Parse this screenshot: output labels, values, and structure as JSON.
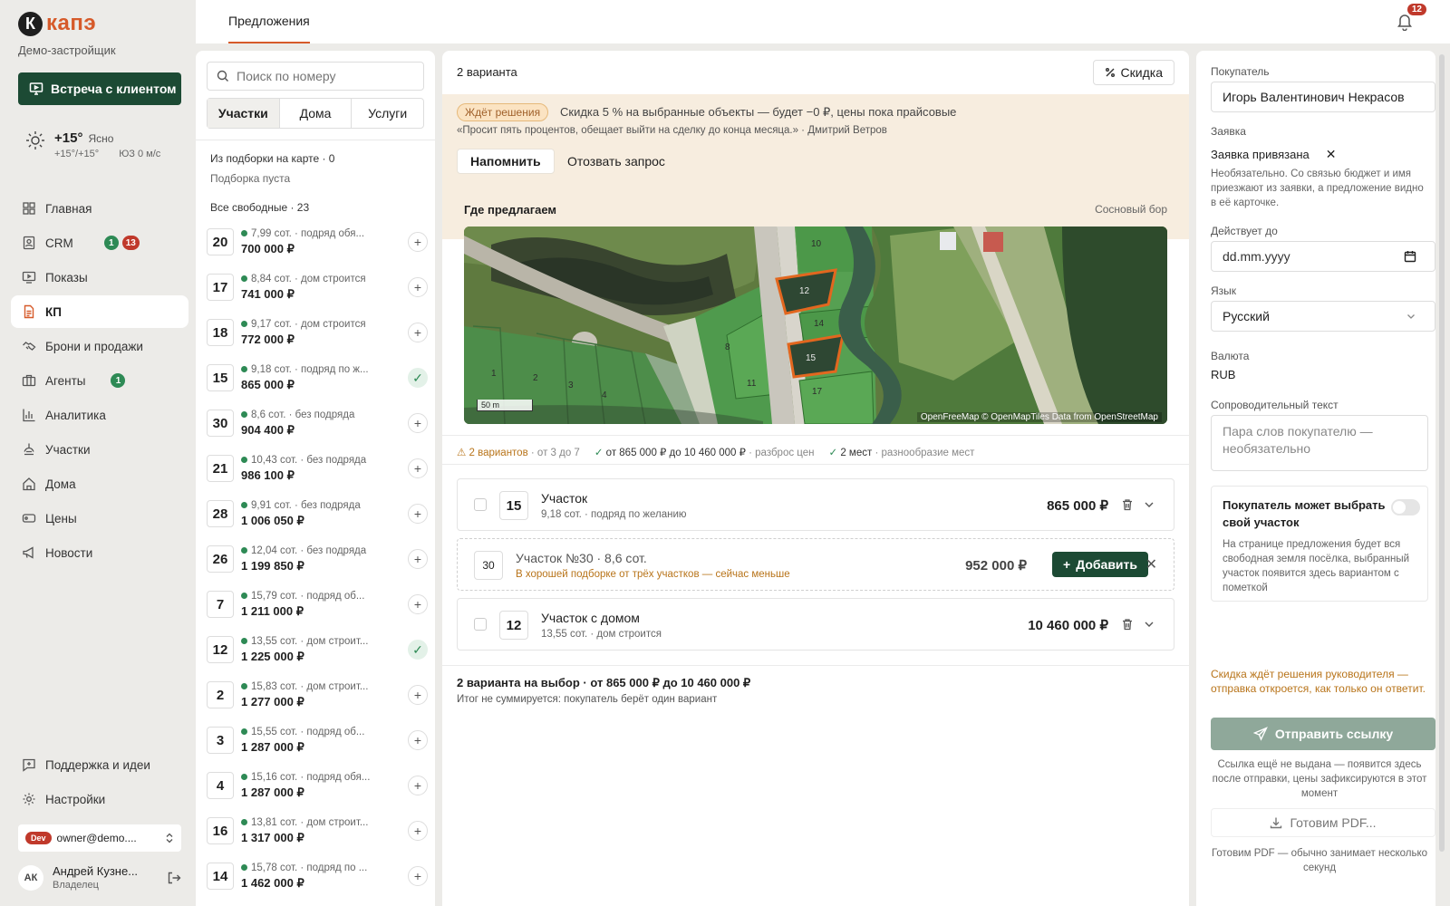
{
  "app": {
    "logo_letter": "К",
    "logo_text": "капэ",
    "company": "Демо-застройщик",
    "meeting_button": "Встреча с клиентом"
  },
  "weather": {
    "temp": "+15°",
    "condition": "Ясно",
    "range": "+15°/+15°",
    "wind": "ЮЗ 0 м/с"
  },
  "nav": {
    "items": [
      {
        "label": "Главная",
        "icon": "grid-icon"
      },
      {
        "label": "CRM",
        "icon": "contacts-icon",
        "badge_green": "1",
        "badge_red": "13"
      },
      {
        "label": "Показы",
        "icon": "screen-icon"
      },
      {
        "label": "КП",
        "icon": "document-icon",
        "active": true
      },
      {
        "label": "Брони и продажи",
        "icon": "handshake-icon"
      },
      {
        "label": "Агенты",
        "icon": "briefcase-icon",
        "badge_green": "1"
      },
      {
        "label": "Аналитика",
        "icon": "chart-icon"
      },
      {
        "label": "Участки",
        "icon": "plot-icon"
      },
      {
        "label": "Дома",
        "icon": "house-icon"
      },
      {
        "label": "Цены",
        "icon": "tag-icon"
      },
      {
        "label": "Новости",
        "icon": "megaphone-icon"
      }
    ],
    "bottom": [
      {
        "label": "Поддержка и идеи",
        "icon": "chat-icon"
      },
      {
        "label": "Настройки",
        "icon": "gear-icon"
      }
    ]
  },
  "user": {
    "env_badge": "Dev",
    "account": "owner@demo....",
    "initials": "АК",
    "name": "Андрей Кузне...",
    "role": "Владелец"
  },
  "topbar": {
    "tab": "Предложения",
    "notifications": "12"
  },
  "list": {
    "search_placeholder": "Поиск по номеру",
    "tabs": [
      "Участки",
      "Дома",
      "Услуги"
    ],
    "from_map": "Из подборки на карте · 0",
    "empty": "Подборка пуста",
    "all_free": "Все свободные · 23",
    "lots": [
      {
        "num": "20",
        "desc": "7,99 сот. · подряд обя...",
        "price": "700 000 ₽",
        "added": false
      },
      {
        "num": "17",
        "desc": "8,84 сот. · дом строится",
        "price": "741 000 ₽",
        "added": false
      },
      {
        "num": "18",
        "desc": "9,17 сот. · дом строится",
        "price": "772 000 ₽",
        "added": false
      },
      {
        "num": "15",
        "desc": "9,18 сот. · подряд по ж...",
        "price": "865 000 ₽",
        "added": true
      },
      {
        "num": "30",
        "desc": "8,6 сот. · без подряда",
        "price": "904 400 ₽",
        "added": false
      },
      {
        "num": "21",
        "desc": "10,43 сот. · без подряда",
        "price": "986 100 ₽",
        "added": false
      },
      {
        "num": "28",
        "desc": "9,91 сот. · без подряда",
        "price": "1 006 050 ₽",
        "added": false
      },
      {
        "num": "26",
        "desc": "12,04 сот. · без подряда",
        "price": "1 199 850 ₽",
        "added": false
      },
      {
        "num": "7",
        "desc": "15,79 сот. · подряд об...",
        "price": "1 211 000 ₽",
        "added": false
      },
      {
        "num": "12",
        "desc": "13,55 сот. · дом строит...",
        "price": "1 225 000 ₽",
        "added": true
      },
      {
        "num": "2",
        "desc": "15,83 сот. · дом строит...",
        "price": "1 277 000 ₽",
        "added": false
      },
      {
        "num": "3",
        "desc": "15,55 сот. · подряд об...",
        "price": "1 287 000 ₽",
        "added": false
      },
      {
        "num": "4",
        "desc": "15,16 сот. · подряд обя...",
        "price": "1 287 000 ₽",
        "added": false
      },
      {
        "num": "16",
        "desc": "13,81 сот. · дом строит...",
        "price": "1 317 000 ₽",
        "added": false
      },
      {
        "num": "14",
        "desc": "15,78 сот. · подряд по ...",
        "price": "1 462 000 ₽",
        "added": false
      }
    ]
  },
  "proposal": {
    "count": "2 варианта",
    "discount_button": "Скидка",
    "alert": {
      "status": "Ждёт решения",
      "text": "Скидка 5 % на выбранные объекты — будет −0 ₽, цены пока прайсовые",
      "quote": "«Просит пять процентов, обещает выйти на сделку до конца месяца.» · Дмитрий Ветров",
      "remind": "Напомнить",
      "revoke": "Отозвать запрос"
    },
    "where_label": "Где предлагаем",
    "village": "Сосновый бор",
    "map": {
      "attribution": "OpenFreeMap © OpenMapTiles Data from OpenStreetMap",
      "scale": "50 m",
      "plot_labels": [
        "10",
        "12",
        "14",
        "15",
        "8",
        "11",
        "17",
        "1",
        "2",
        "3",
        "4"
      ]
    },
    "metrics": [
      {
        "strong": "2 вариантов",
        "rest": "· от 3 до 7",
        "icon": "warning-icon"
      },
      {
        "strong": "от 865 000 ₽ до 10 460 000 ₽",
        "rest": "· разброс цен",
        "icon": "check-icon"
      },
      {
        "strong": "2 мест",
        "rest": "· разнообразие мест",
        "icon": "check-icon"
      }
    ],
    "items": [
      {
        "num": "15",
        "title": "Участок",
        "sub": "9,18 сот. · подряд по желанию",
        "price": "865 000 ₽"
      },
      {
        "num": "12",
        "title": "Участок с домом",
        "sub": "13,55 сот. · дом строится",
        "price": "10 460 000 ₽"
      }
    ],
    "suggestion": {
      "num": "30",
      "title": "Участок №30 · 8,6 сот.",
      "sub": "В хорошей подборке от трёх участков — сейчас меньше",
      "price": "952 000 ₽",
      "add": "Добавить"
    },
    "total": "2 варианта на выбор · от 865 000 ₽ до 10 460 000 ₽",
    "total_sub": "Итог не суммируется: покупатель берёт один вариант"
  },
  "side": {
    "buyer_label": "Покупатель",
    "buyer": "Игорь Валентинович Некрасов",
    "request_label": "Заявка",
    "request": "Заявка привязана",
    "request_help": "Необязательно. Со связью бюджет и имя приезжают из заявки, а предложение видно в её карточке.",
    "valid_label": "Действует до",
    "valid_placeholder": "dd.mm.yyyy",
    "lang_label": "Язык",
    "lang": "Русский",
    "currency_label": "Валюта",
    "currency": "RUB",
    "note_label": "Сопроводительный текст",
    "note_placeholder": "Пара слов покупателю — необязательно",
    "choose_title": "Покупатель может выбрать свой участок",
    "choose_help": "На странице предложения будет вся свободная земля посёлка, выбранный участок появится здесь вариантом с пометкой",
    "warn": "Скидка ждёт решения руководителя — отправка откроется, как только он ответит.",
    "send": "Отправить ссылку",
    "send_note": "Ссылка ещё не выдана — появится здесь после отправки, цены зафиксируются в этот момент",
    "pdf": "Готовим PDF...",
    "pdf_note": "Готовим PDF — обычно занимает несколько секунд"
  },
  "colors": {
    "accent": "#d65a2a",
    "primary": "#1c4a34",
    "success": "#2e8a55",
    "warning": "#b8741a",
    "danger": "#c0392b"
  }
}
